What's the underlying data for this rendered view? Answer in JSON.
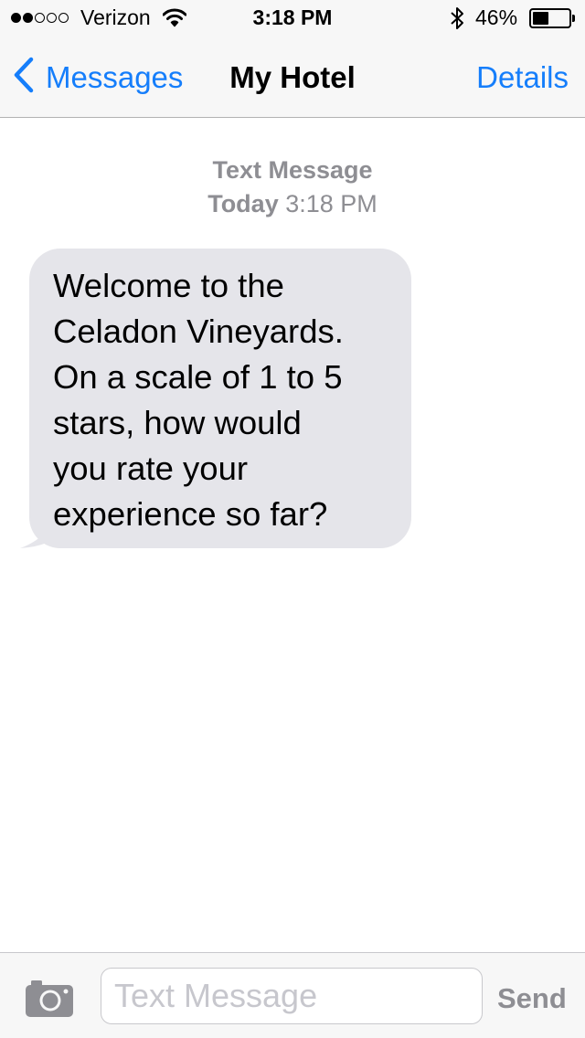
{
  "status_bar": {
    "signal_strength": 2,
    "signal_total": 5,
    "carrier": "Verizon",
    "time": "3:18 PM",
    "bluetooth_icon": "bluetooth-icon",
    "battery_percent": "46%",
    "battery_level": 0.46
  },
  "nav": {
    "back_label": "Messages",
    "title": "My Hotel",
    "details_label": "Details"
  },
  "conversation": {
    "service": "Text Message",
    "day": "Today",
    "time": "3:18 PM",
    "messages": [
      {
        "direction": "incoming",
        "lines": [
          "Welcome to the",
          "Celadon Vineyards.",
          "On a scale of 1 to 5",
          "stars, how would",
          "you rate your",
          "experience so far?"
        ]
      }
    ]
  },
  "input_bar": {
    "camera_icon": "camera-icon",
    "placeholder": "Text Message",
    "value": "",
    "send_label": "Send"
  },
  "colors": {
    "accent": "#157efb",
    "bubble": "#e5e5ea",
    "muted_text": "#8e8e93"
  }
}
